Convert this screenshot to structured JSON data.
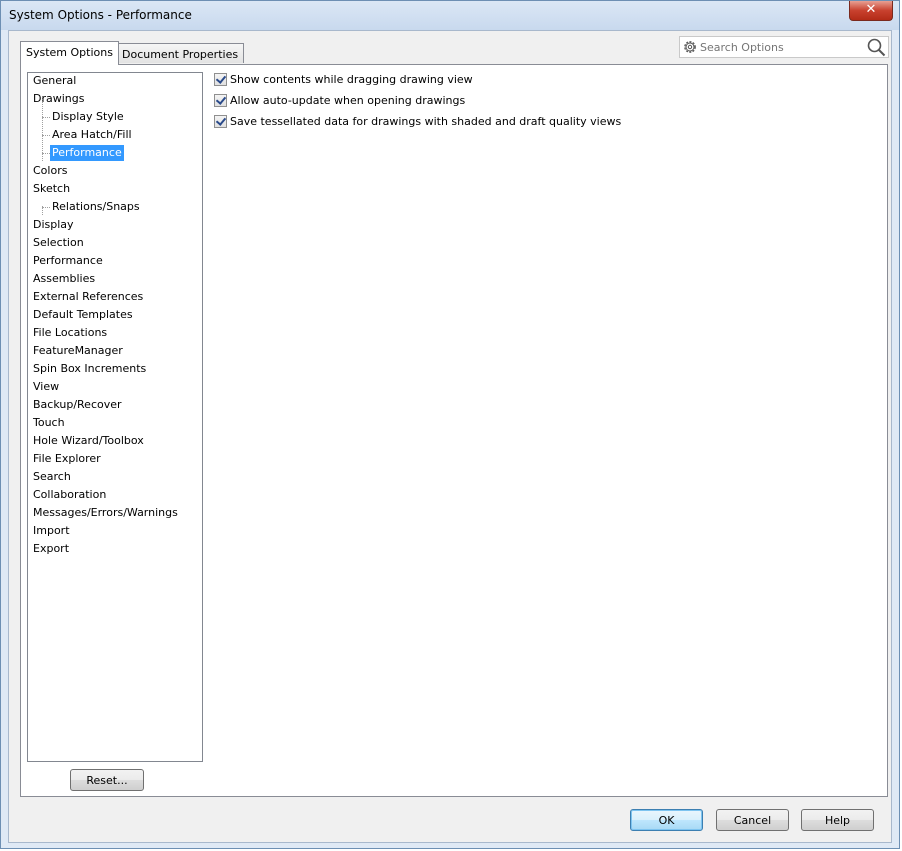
{
  "window": {
    "title": "System Options - Performance",
    "close_glyph": "✕"
  },
  "tabs": [
    {
      "label": "System Options",
      "active": true
    },
    {
      "label": "Document Properties",
      "active": false
    }
  ],
  "search": {
    "placeholder": "Search Options",
    "icon": "gear-icon"
  },
  "tree": {
    "items": [
      "General",
      "Drawings",
      "Display Style",
      "Area Hatch/Fill",
      "Performance",
      "Colors",
      "Sketch",
      "Relations/Snaps",
      "Display",
      "Selection",
      "Performance",
      "Assemblies",
      "External References",
      "Default Templates",
      "File Locations",
      "FeatureManager",
      "Spin Box Increments",
      "View",
      "Backup/Recover",
      "Touch",
      "Hole Wizard/Toolbox",
      "File Explorer",
      "Search",
      "Collaboration",
      "Messages/Errors/Warnings",
      "Import",
      "Export"
    ],
    "selected": "Performance"
  },
  "options": [
    {
      "label": "Show contents while dragging drawing view",
      "checked": true
    },
    {
      "label": "Allow auto-update when opening drawings",
      "checked": true
    },
    {
      "label": "Save tessellated data for drawings with shaded and draft quality views",
      "checked": true
    }
  ],
  "buttons": {
    "reset": "Reset...",
    "ok": "OK",
    "cancel": "Cancel",
    "help": "Help"
  },
  "colors": {
    "selection": "#3399ff",
    "title_bar": "#c8d9ee"
  }
}
